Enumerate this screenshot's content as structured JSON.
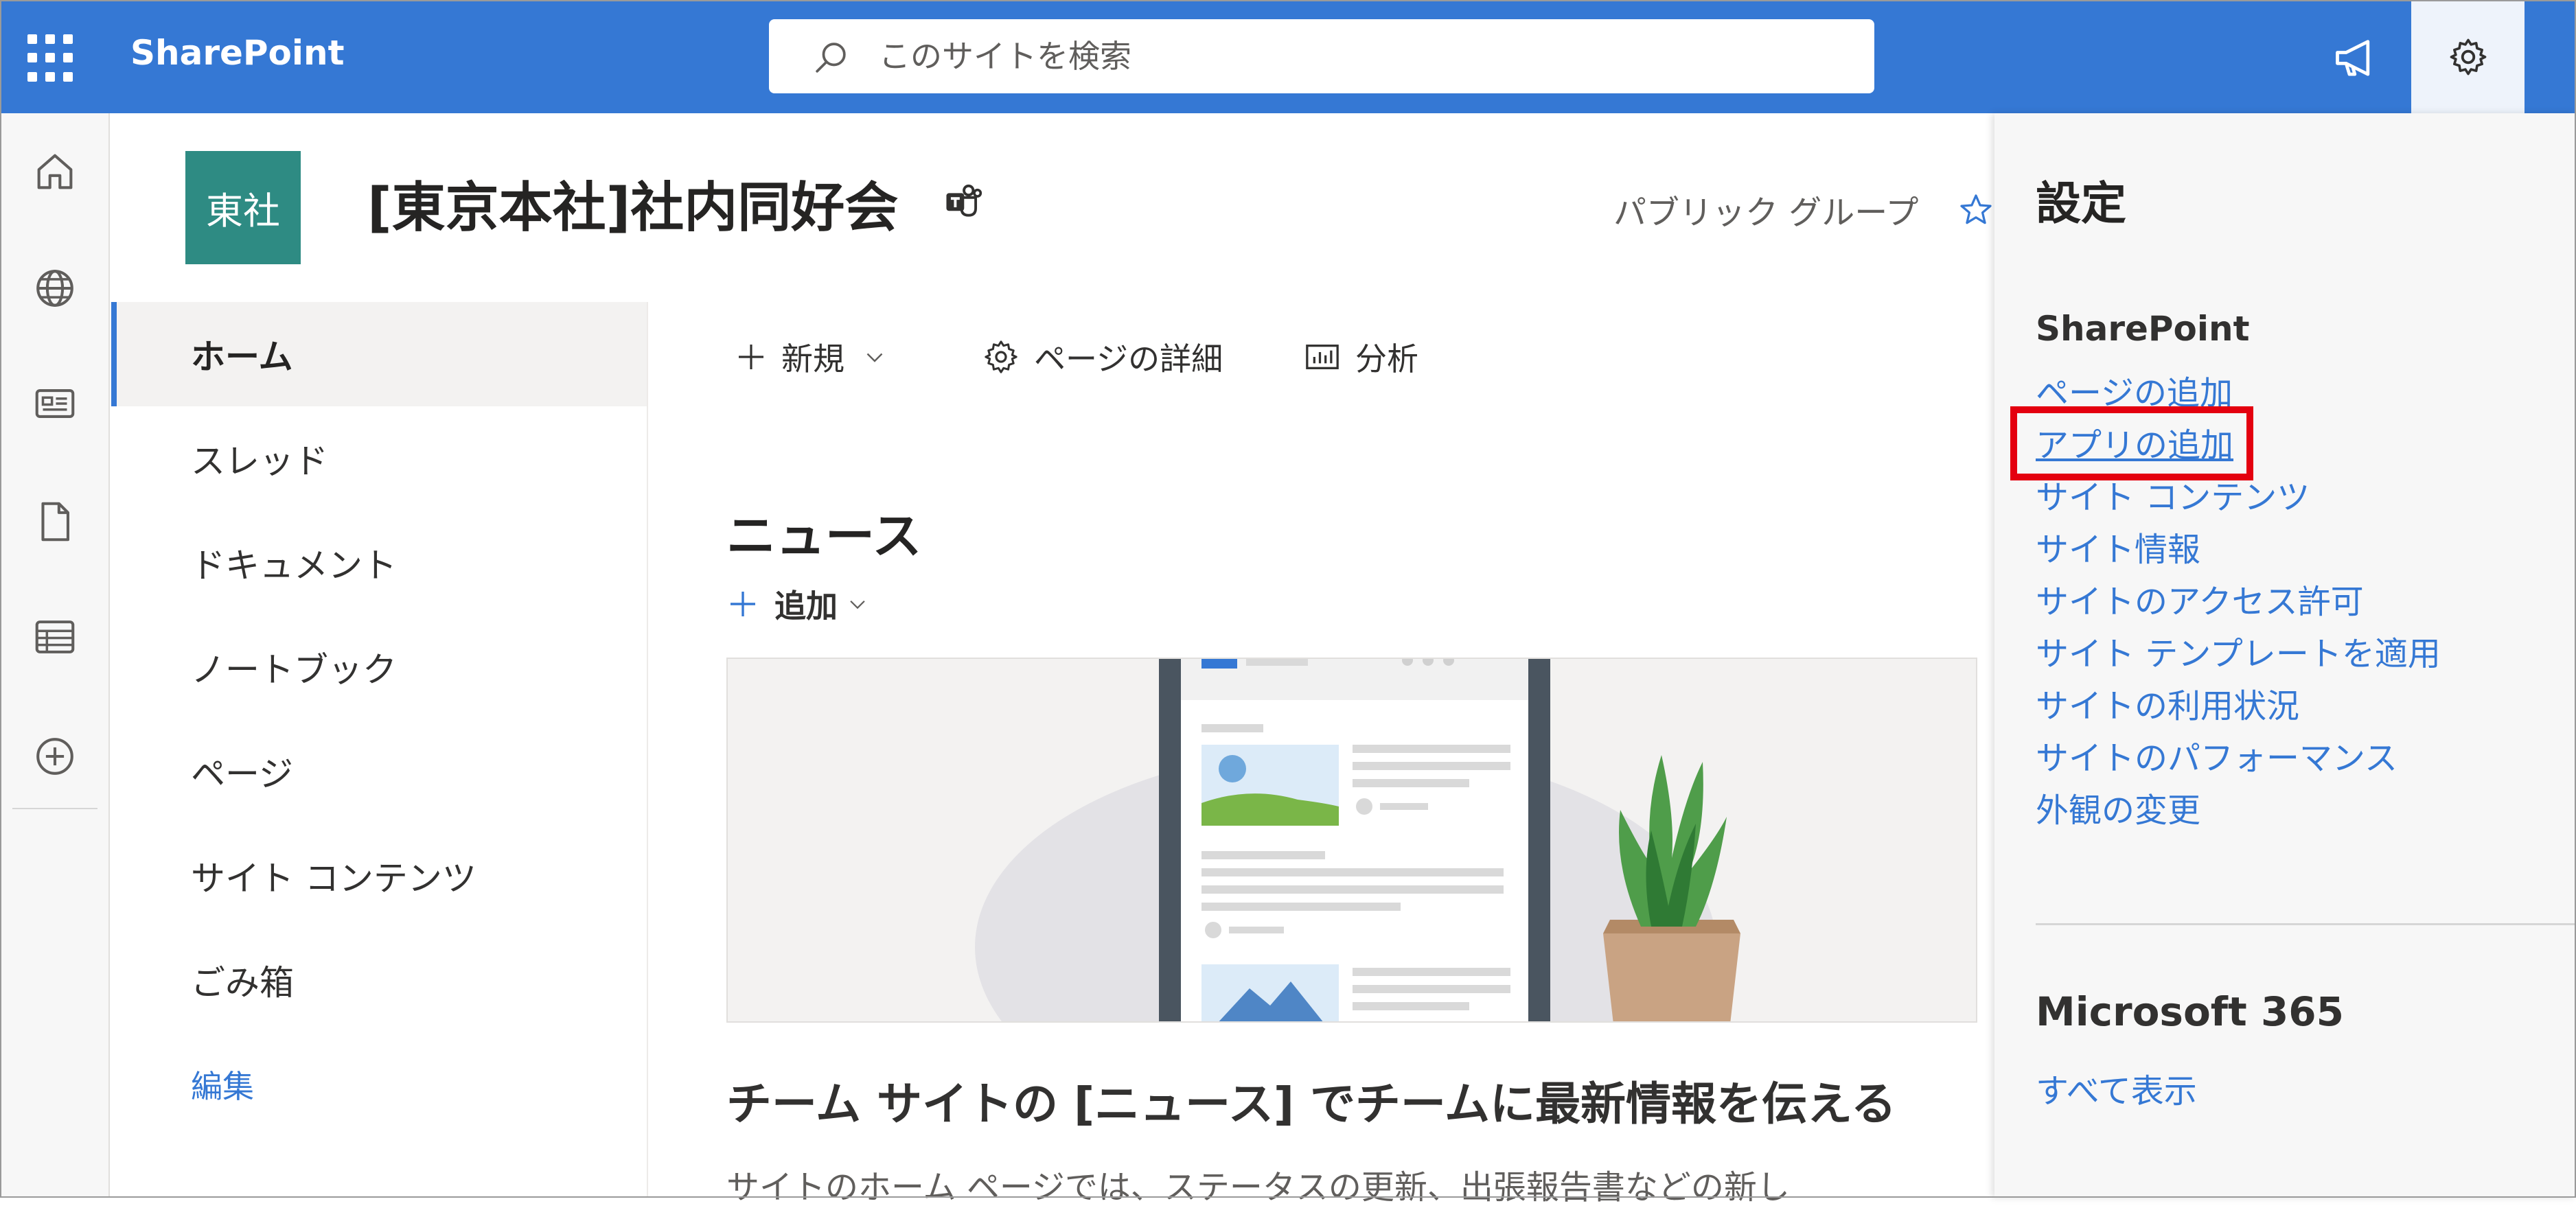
{
  "topbar": {
    "brand": "SharePoint",
    "search_placeholder": "このサイトを検索",
    "icons": [
      "waffle-icon",
      "search-icon",
      "megaphone-icon",
      "gear-icon"
    ]
  },
  "site": {
    "logo_text": "東社",
    "title": "[東京本社]社内同好会",
    "group_label": "パブリック グループ",
    "accent_color": "#2e8b83"
  },
  "leftnav": {
    "items": [
      {
        "label": "ホーム",
        "active": true
      },
      {
        "label": "スレッド"
      },
      {
        "label": "ドキュメント"
      },
      {
        "label": "ノートブック"
      },
      {
        "label": "ページ"
      },
      {
        "label": "サイト コンテンツ"
      },
      {
        "label": "ごみ箱"
      }
    ],
    "edit_label": "編集"
  },
  "commandbar": {
    "new_label": "新規",
    "page_details_label": "ページの詳細",
    "analytics_label": "分析"
  },
  "news": {
    "title": "ニュース",
    "add_label": "追加",
    "headline": "チーム サイトの [ニュース] でチームに最新情報を伝える",
    "description": "サイトのホーム ページでは、ステータスの更新、出張報告書などの新し"
  },
  "settings_panel": {
    "title": "設定",
    "sharepoint_heading": "SharePoint",
    "links": [
      "ページの追加",
      "アプリの追加",
      "サイト コンテンツ",
      "サイト情報",
      "サイトのアクセス許可",
      "サイト テンプレートを適用",
      "サイトの利用状況",
      "サイトのパフォーマンス",
      "外観の変更"
    ],
    "highlighted_link": "アプリの追加",
    "m365_heading": "Microsoft 365",
    "show_all_label": "すべて表示"
  },
  "colors": {
    "suite_bar": "#3578d4",
    "link": "#3578d4",
    "highlight": "#e4000f"
  }
}
